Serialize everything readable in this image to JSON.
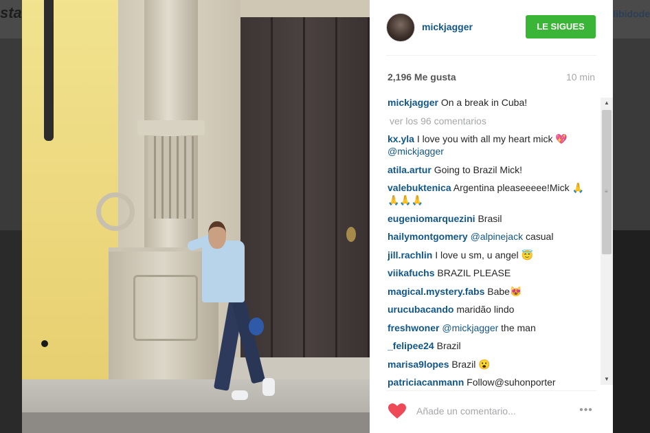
{
  "background": {
    "brand_fragment": "stag",
    "right_fragment": "libidode"
  },
  "post": {
    "photo_alt": "photo",
    "author": "mickjagger",
    "follow_label": "LE SIGUES",
    "likes": "2,196 Me gusta",
    "time": "10 min",
    "view_all": "ver los 96 comentarios",
    "caption": {
      "user": "mickjagger",
      "text": " On a break in Cuba!"
    },
    "comments": [
      {
        "user": "kx.yla",
        "text": " I love you with all my heart mick 💖 ",
        "mention": "@mickjagger",
        "after": ""
      },
      {
        "user": "atila.artur",
        "text": " Going to Brazil Mick!",
        "mention": "",
        "after": ""
      },
      {
        "user": "valebuktenica",
        "text": " Argentina pleaseeeee!Mick 🙏🙏🙏🙏",
        "mention": "",
        "after": ""
      },
      {
        "user": "eugeniomarquezini",
        "text": " Brasil",
        "mention": "",
        "after": ""
      },
      {
        "user": "hailymontgomery",
        "text": " ",
        "mention": "@alpinejack",
        "after": " casual"
      },
      {
        "user": "jill.rachlin",
        "text": " I love u sm, u angel 😇",
        "mention": "",
        "after": ""
      },
      {
        "user": "viikafuchs",
        "text": " BRAZIL PLEASE",
        "mention": "",
        "after": ""
      },
      {
        "user": "magical.mystery.fabs",
        "text": " Babe😻",
        "mention": "",
        "after": ""
      },
      {
        "user": "urucubacando",
        "text": " maridão lindo",
        "mention": "",
        "after": ""
      },
      {
        "user": "freshwoner",
        "text": " ",
        "mention": "@mickjagger",
        "after": " the man"
      },
      {
        "user": "_felipee24",
        "text": " Brazil",
        "mention": "",
        "after": ""
      },
      {
        "user": "marisa9lopes",
        "text": " Brazil 😮",
        "mention": "",
        "after": ""
      },
      {
        "user": "patriciacanmann",
        "text": " Follow@suhonporter",
        "mention": "",
        "after": ""
      }
    ],
    "comment_placeholder": "Añade un comentario...",
    "more_label": "•••",
    "like_color": "#ed4956",
    "follow_color": "#3bb537",
    "link_color": "#125688"
  }
}
